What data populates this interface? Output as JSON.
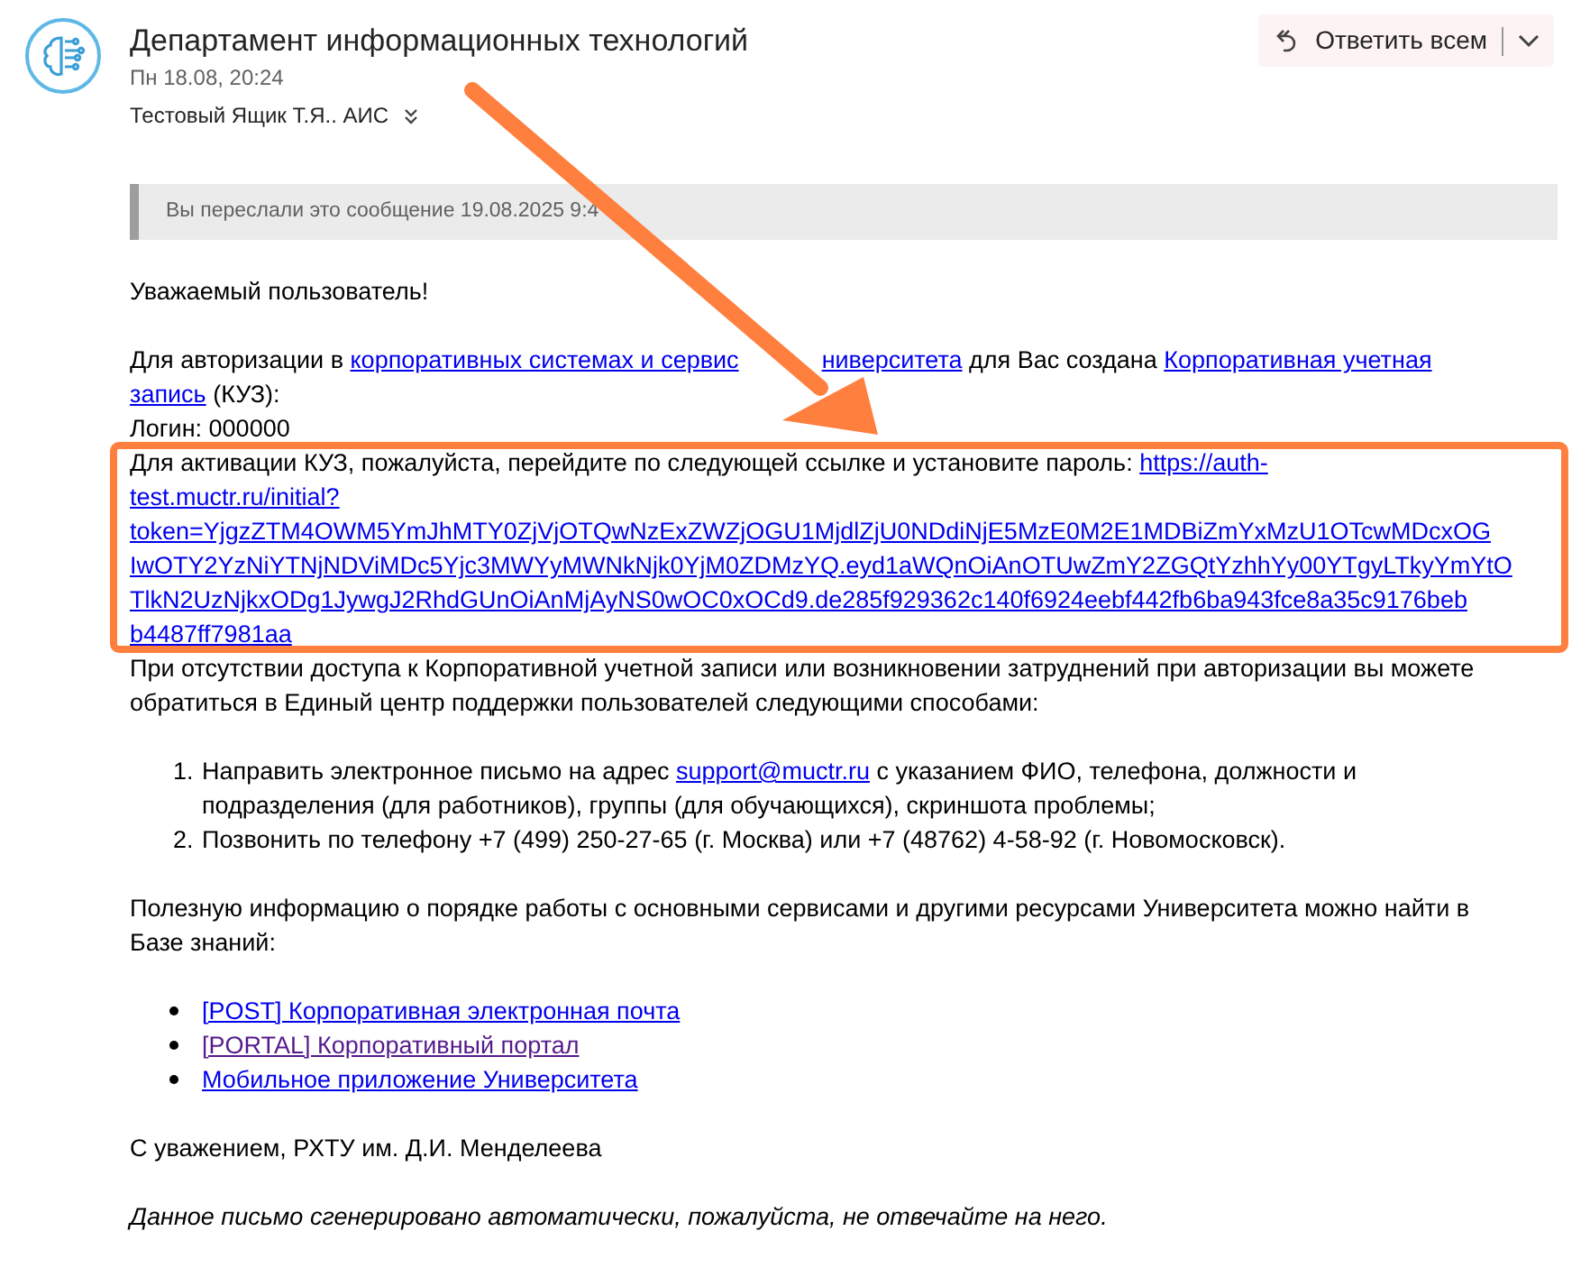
{
  "header": {
    "sender": "Департамент информационных технологий",
    "date": "Пн 18.08, 20:24",
    "recipients": "Тестовый Ящик Т.Я.. АИС",
    "reply_button": {
      "label": "Ответить всем"
    }
  },
  "forwarded_notice": "Вы переслали это сообщение 19.08.2025 9:4",
  "body": [
    {
      "kind": "paragraph",
      "segments": [
        {
          "text": "Уважаемый пользователь!"
        }
      ]
    },
    {
      "kind": "line",
      "segments": [
        {
          "text": "Для авторизации в "
        },
        {
          "text": "корпоративных системах и сервис",
          "kind": "cut_link"
        },
        {
          "text": "ниверситета",
          "kind": "link"
        },
        {
          "text": " для Вас создана "
        },
        {
          "kind": "wrapped_link",
          "lines": [
            "Корпоративная учетная",
            "запись"
          ]
        },
        {
          "text": " (КУЗ):"
        }
      ]
    },
    {
      "kind": "line",
      "segments": [
        {
          "text": "Логин: 000000"
        }
      ]
    },
    {
      "kind": "line",
      "highlighted": true,
      "segments": [
        {
          "text": "Для активации КУЗ, пожалуйста, перейдите по следующей ссылке и установите пароль: "
        },
        {
          "kind": "wrapped_link",
          "lines": [
            "https://auth-",
            "test.muctr.ru/initial?",
            "token=YjgzZTM4OWM5YmJhMTY0ZjVjOTQwNzExZWZjOGU1MjdlZjU0NDdiNjE5MzE0M2E1MDBiZmYxMzU1OTcwMDcxOG",
            "IwOTY2YzNiYTNjNDViMDc5Yjc3MWYyMWNkNjk0YjM0ZDMzYQ.eyd1aWQnOiAnOTUwZmY2ZGQtYzhhYy00YTgyLTkyYmYtO",
            "TlkN2UzNjkxODg1JywgJ2RhdGUnOiAnMjAyNS0wOC0xOCd9.de285f929362c140f6924eebf442fb6ba943fce8a35c9176beb",
            "b4487ff7981aa"
          ]
        }
      ]
    },
    {
      "kind": "line",
      "segments": [
        {
          "text": "При отсутствии доступа к Корпоративной учетной записи или возникновении затруднений при авторизации вы можете обратиться в Единый центр поддержки пользователей следующими способами:"
        }
      ]
    },
    {
      "kind": "numbered",
      "items": [
        {
          "number": "1.",
          "segments": [
            {
              "text": "Направить электронное письмо на адрес "
            },
            {
              "text": "support@muctr.ru",
              "kind": "link"
            },
            {
              "text": " с указанием ФИО, телефона, должности и подразделения (для работников), группы (для обучающихся), скриншота проблемы;"
            }
          ]
        },
        {
          "number": "2.",
          "segments": [
            {
              "text": "Позвонить по телефону +7 (499) 250-27-65 (г. Москва) или +7 (48762) 4-58-92 (г. Новомосковск)."
            }
          ]
        }
      ]
    },
    {
      "kind": "paragraph",
      "segments": [
        {
          "text": "Полезную информацию о порядке работы с основными сервисами и другими ресурсами Университета можно найти в Базе знаний:"
        }
      ]
    },
    {
      "kind": "bullets",
      "items": [
        {
          "text": "[POST] Корпоративная электронная почта",
          "visited": false
        },
        {
          "text": "[PORTAL] Корпоративный портал",
          "visited": true
        },
        {
          "text": "Мобильное приложение Университета",
          "visited": false
        }
      ]
    },
    {
      "kind": "paragraph",
      "segments": [
        {
          "text": "С уважением, РХТУ им. Д.И. Менделеева"
        }
      ]
    },
    {
      "kind": "italic",
      "segments": [
        {
          "text": "Данное письмо сгенерировано автоматически, пожалуйста, не отвечайте на него."
        }
      ]
    }
  ]
}
